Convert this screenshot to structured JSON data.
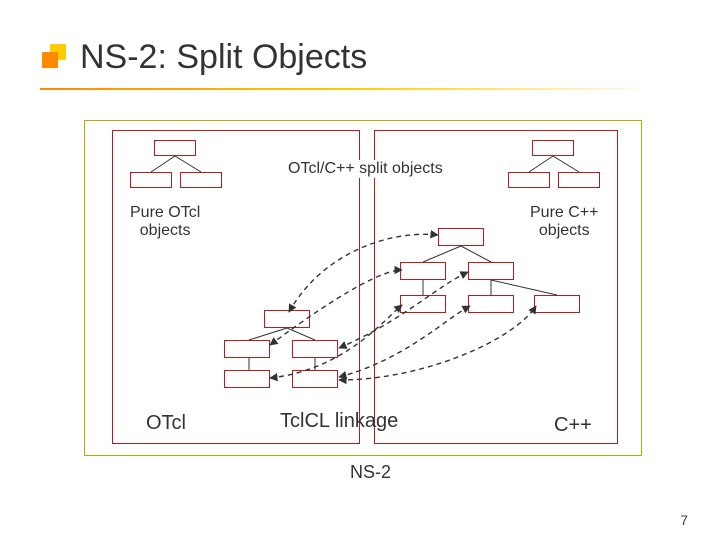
{
  "slide": {
    "title": "NS-2: Split Objects",
    "page_number": "7",
    "diagram": {
      "split_objects_label": "OTcl/C++ split objects",
      "pure_otcl_label_line1": "Pure OTcl",
      "pure_otcl_label_line2": "objects",
      "pure_cpp_label_line1": "Pure C++",
      "pure_cpp_label_line2": "objects",
      "linkage_label": "TclCL linkage",
      "otcl_label": "OTcl",
      "cpp_label": "C++",
      "ns2_label": "NS-2"
    }
  }
}
